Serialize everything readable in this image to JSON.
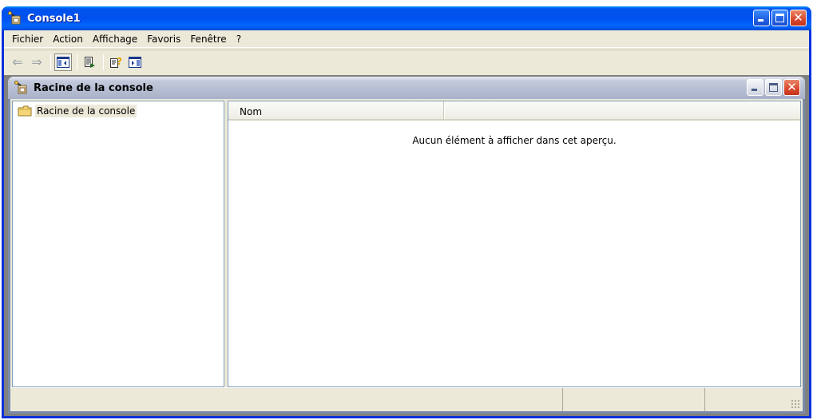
{
  "window": {
    "title": "Console1",
    "icon": "console-root-icon"
  },
  "menu": {
    "items": [
      "Fichier",
      "Action",
      "Affichage",
      "Favoris",
      "Fenêtre",
      "?"
    ]
  },
  "toolbar": {
    "buttons": [
      "back-arrow-icon",
      "forward-arrow-icon",
      "show-hide-tree-icon",
      "export-list-icon",
      "help-icon",
      "show-hide-action-pane-icon"
    ]
  },
  "inner_window": {
    "title": "Racine de la console",
    "icon": "console-root-icon"
  },
  "tree": {
    "root_label": "Racine de la console",
    "root_icon": "folder-icon"
  },
  "list": {
    "column_name": "Nom",
    "empty_message": "Aucun élément à afficher dans cet aperçu."
  },
  "colors": {
    "titlebar_blue": "#0053ee",
    "window_face": "#ece9d8",
    "mdi_background": "#808080"
  }
}
